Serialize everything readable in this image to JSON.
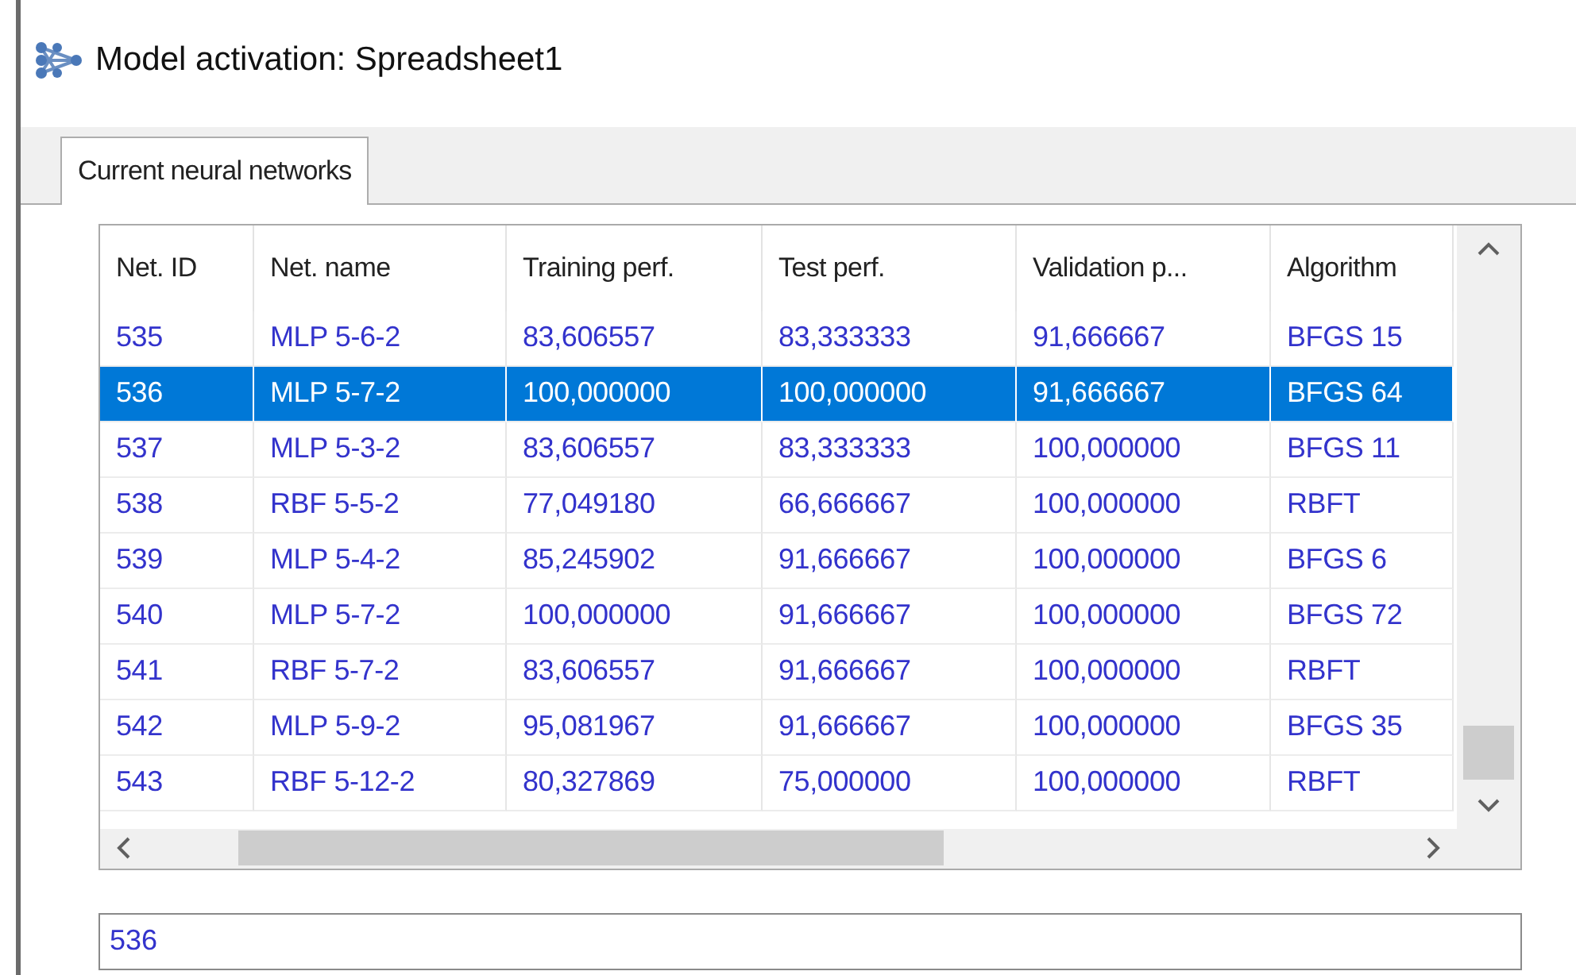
{
  "window": {
    "title": "Model activation: Spreadsheet1"
  },
  "tabs": [
    {
      "label": "Current neural networks",
      "selected": true
    }
  ],
  "table": {
    "columns": [
      "Net. ID",
      "Net. name",
      "Training perf.",
      "Test perf.",
      "Validation p...",
      "Algorithm"
    ],
    "rows": [
      {
        "cells": [
          "535",
          "MLP 5-6-2",
          "83,606557",
          "83,333333",
          "91,666667",
          "BFGS 15"
        ],
        "selected": false
      },
      {
        "cells": [
          "536",
          "MLP 5-7-2",
          "100,000000",
          "100,000000",
          "91,666667",
          "BFGS 64"
        ],
        "selected": true
      },
      {
        "cells": [
          "537",
          "MLP 5-3-2",
          "83,606557",
          "83,333333",
          "100,000000",
          "BFGS 11"
        ],
        "selected": false
      },
      {
        "cells": [
          "538",
          "RBF 5-5-2",
          "77,049180",
          "66,666667",
          "100,000000",
          "RBFT"
        ],
        "selected": false
      },
      {
        "cells": [
          "539",
          "MLP 5-4-2",
          "85,245902",
          "91,666667",
          "100,000000",
          "BFGS 6"
        ],
        "selected": false
      },
      {
        "cells": [
          "540",
          "MLP 5-7-2",
          "100,000000",
          "91,666667",
          "100,000000",
          "BFGS 72"
        ],
        "selected": false
      },
      {
        "cells": [
          "541",
          "RBF 5-7-2",
          "83,606557",
          "91,666667",
          "100,000000",
          "RBFT"
        ],
        "selected": false
      },
      {
        "cells": [
          "542",
          "MLP 5-9-2",
          "95,081967",
          "91,666667",
          "100,000000",
          "BFGS 35"
        ],
        "selected": false
      },
      {
        "cells": [
          "543",
          "RBF 5-12-2",
          "80,327869",
          "75,000000",
          "100,000000",
          "RBFT"
        ],
        "selected": false
      }
    ]
  },
  "selected_net_field": {
    "value": "536"
  }
}
